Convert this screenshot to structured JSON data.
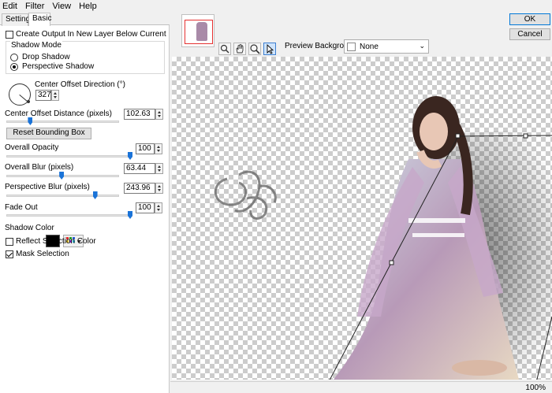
{
  "menu": [
    "Edit",
    "Filter",
    "View",
    "Help"
  ],
  "tabs": {
    "settings": "Settings",
    "basic": "Basic"
  },
  "options": {
    "create_output": {
      "label": "Create Output In New Layer Below Current",
      "checked": false
    },
    "shadow_mode": {
      "title": "Shadow Mode",
      "drop": "Drop Shadow",
      "perspective": "Perspective Shadow",
      "selected": "perspective"
    },
    "center_offset_direction": {
      "label": "Center Offset Direction (°)",
      "value": "327"
    },
    "center_offset_distance": {
      "label": "Center Offset Distance (pixels)",
      "value": "102.63",
      "fraction": 0.2
    },
    "reset_bounding_box": "Reset Bounding Box",
    "overall_opacity": {
      "label": "Overall Opacity",
      "value": "100",
      "fraction": 1.0
    },
    "overall_blur": {
      "label": "Overall Blur (pixels)",
      "value": "63.44",
      "fraction": 0.49
    },
    "perspective_blur": {
      "label": "Perspective Blur (pixels)",
      "value": "243.96",
      "fraction": 0.8
    },
    "fade_out": {
      "label": "Fade Out",
      "value": "100",
      "fraction": 1.0
    },
    "shadow_color": {
      "label": "Shadow Color",
      "color": "#000000"
    },
    "reflect_selection_color": {
      "label": "Reflect Selection Color",
      "checked": false
    },
    "mask_selection": {
      "label": "Mask Selection",
      "checked": true
    }
  },
  "preview": {
    "background_label": "Preview Background:",
    "background_value": "None",
    "tools": [
      "zoom-fit-icon",
      "hand-icon",
      "magnifier-icon",
      "arrow-pointer-icon"
    ]
  },
  "buttons": {
    "ok": "OK",
    "cancel": "Cancel"
  },
  "status": {
    "zoom": "100%"
  },
  "colors": {
    "accent": "#1a73d8",
    "thumbnail_frame": "#e53030"
  }
}
